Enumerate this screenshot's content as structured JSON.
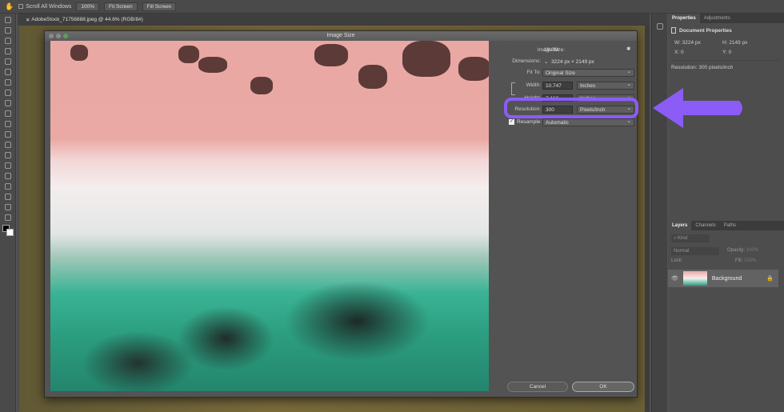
{
  "options_bar": {
    "scroll_all_windows": "Scroll All Windows",
    "zoom_100": "100%",
    "fit_screen": "Fit Screen",
    "fill_screen": "Fill Screen"
  },
  "document_tab": {
    "title": "AdobeStock_71756888.jpeg @ 44.6% (RGB/8#)"
  },
  "dialog": {
    "title": "Image Size",
    "image_size_label": "Image Size:",
    "image_size_value": "19.8M",
    "dimensions_label": "Dimensions:",
    "dimensions_value": "3224 px  ×  2149 px",
    "fit_to_label": "Fit To:",
    "fit_to_value": "Original Size",
    "width_label": "Width:",
    "width_value": "10.747",
    "width_unit": "Inches",
    "height_label": "Height:",
    "height_value": "7.163",
    "height_unit": "Inches",
    "resolution_label": "Resolution:",
    "resolution_value": "300",
    "resolution_unit": "Pixels/Inch",
    "resample_label": "Resample:",
    "resample_value": "Automatic",
    "resample_checked": true,
    "cancel": "Cancel",
    "ok": "OK"
  },
  "highlight_color": "#8b5cf6",
  "properties": {
    "tabs": [
      "Properties",
      "Adjustments"
    ],
    "heading": "Document Properties",
    "w": "W:  3224 px",
    "h": "H:  2149 px",
    "x": "X:  0",
    "y": "Y:  0",
    "resolution": "Resolution: 300 pixels/inch"
  },
  "layers": {
    "tabs": [
      "Layers",
      "Channels",
      "Paths"
    ],
    "filter_placeholder": "Kind",
    "blend_mode": "Normal",
    "opacity_label": "Opacity:",
    "opacity_value": "100%",
    "lock_label": "Lock:",
    "fill_label": "Fill:",
    "fill_value": "100%",
    "layer_name": "Background"
  }
}
